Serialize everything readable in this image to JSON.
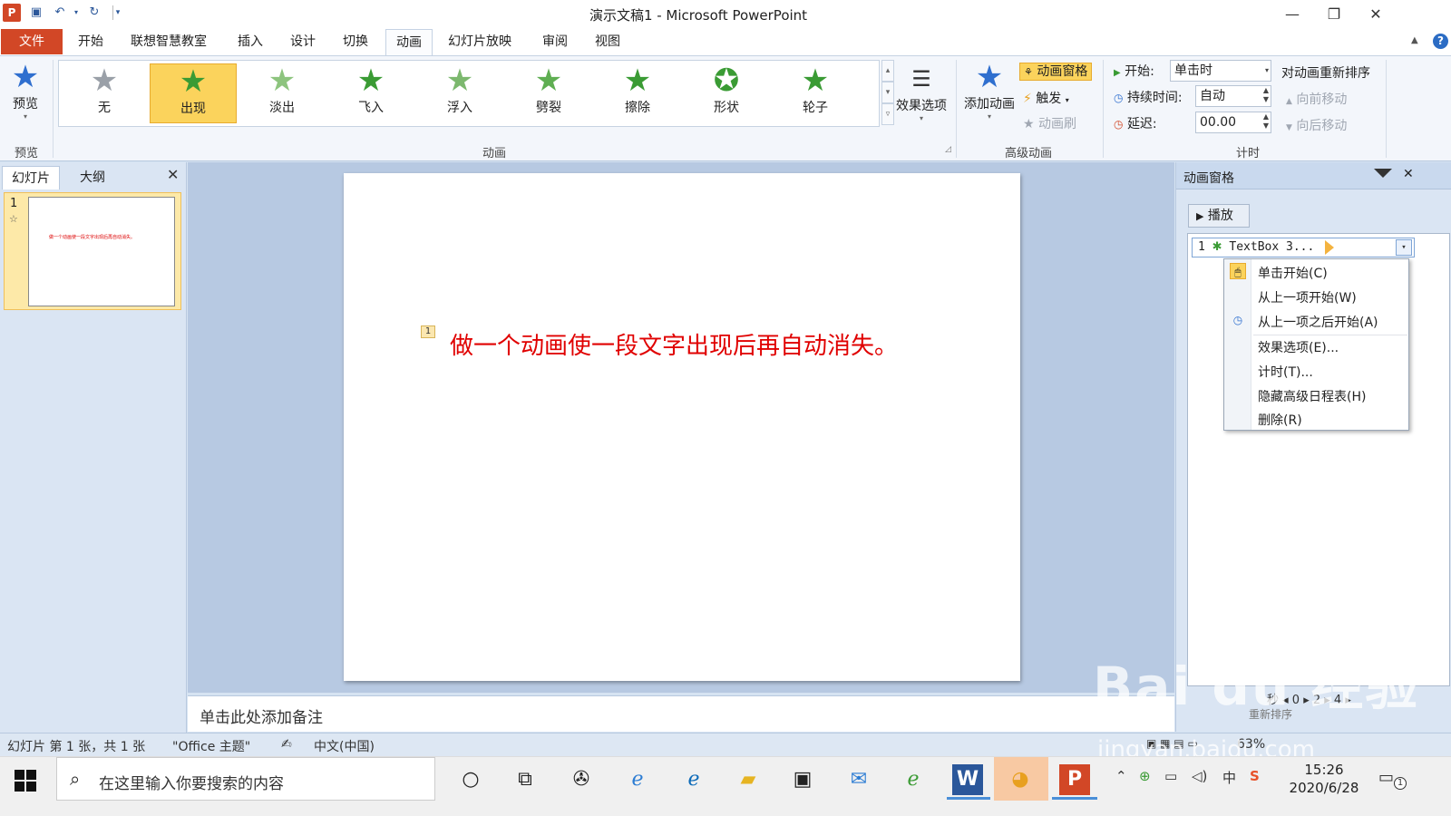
{
  "window": {
    "title": "演示文稿1 - Microsoft PowerPoint",
    "app_logo": "P"
  },
  "menu": {
    "file": "文件",
    "tabs": [
      "开始",
      "联想智慧教室",
      "插入",
      "设计",
      "切换",
      "动画",
      "幻灯片放映",
      "审阅",
      "视图"
    ],
    "active_tab": "动画"
  },
  "ribbon": {
    "preview": {
      "label": "预览",
      "group_label": "预览"
    },
    "animations": {
      "group_label": "动画",
      "items": [
        "无",
        "出现",
        "淡出",
        "飞入",
        "浮入",
        "劈裂",
        "擦除",
        "形状",
        "轮子"
      ],
      "selected": "出现"
    },
    "effect_options": "效果选项",
    "advanced": {
      "group_label": "高级动画",
      "add_animation": "添加动画",
      "animation_pane": "动画窗格",
      "trigger": "触发",
      "painter": "动画刷"
    },
    "timing": {
      "group_label": "计时",
      "start_label": "开始:",
      "start_value": "单击时",
      "duration_label": "持续时间:",
      "duration_value": "自动",
      "delay_label": "延迟:",
      "delay_value": "00.00",
      "reorder_title": "对动画重新排序",
      "move_earlier": "向前移动",
      "move_later": "向后移动"
    }
  },
  "left_panel": {
    "tab_slides": "幻灯片",
    "tab_outline": "大纲",
    "slide_number": "1",
    "thumb_text": "做一个动画使一段文字出现后再自动消失。"
  },
  "slide": {
    "anim_tag": "1",
    "text": "做一个动画使一段文字出现后再自动消失。"
  },
  "notes": {
    "placeholder": "单击此处添加备注"
  },
  "anim_pane": {
    "title": "动画窗格",
    "play": "播放",
    "item_index": "1",
    "item_name": "TextBox 3...",
    "menu": [
      "单击开始(C)",
      "从上一项开始(W)",
      "从上一项之后开始(A)",
      "效果选项(E)...",
      "计时(T)...",
      "隐藏高级日程表(H)",
      "删除(R)"
    ],
    "footer": "秒 ◂ 0 ▸ 2 ▸ 4 ▸",
    "reorder": "重新排序"
  },
  "statusbar": {
    "slide_info": "幻灯片 第 1 张，共 1 张",
    "theme": "\"Office 主题\"",
    "language": "中文(中国)",
    "zoom": "63%"
  },
  "taskbar": {
    "search_placeholder": "在这里输入你要搜索的内容",
    "time": "15:26",
    "date": "2020/6/28",
    "ime": "中",
    "notifications": "1"
  },
  "watermark": {
    "brand": "Bai du 经验",
    "url": "jingyan.baidu.com"
  },
  "colors": {
    "accent": "#d24726",
    "selected": "#fbd35c",
    "slide_text": "#e00000"
  }
}
